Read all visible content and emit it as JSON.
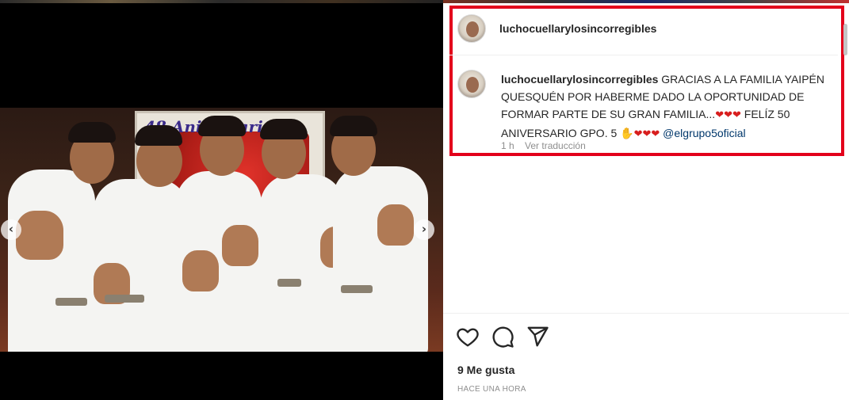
{
  "post": {
    "username": "luchocuellarylosincorregibles",
    "banner_text": "48 Aniversario",
    "caption": {
      "username": "luchocuellarylosincorregibles",
      "text_part1": "GRACIAS A LA FAMILIA YAIPÉN QUESQUÉN POR HABERME DADO LA OPORTUNIDAD DE FORMAR PARTE DE SU GRAN FAMILIA...",
      "hearts_a": "❤❤❤",
      "text_part2": "FELÍZ 50 ANIVERSARIO GPO. 5",
      "hand_emoji": "✋",
      "hearts_b": "❤❤❤",
      "mention": "@elgrupo5oficial"
    },
    "comment_meta": {
      "time": "1 h",
      "translate": "Ver traducción"
    },
    "likes": "9 Me gusta",
    "posted": "HACE UNA HORA",
    "nav_prev": "‹",
    "nav_next": "›"
  },
  "icons": {
    "like": "heart-outline-icon",
    "comment": "speech-bubble-icon",
    "share": "paper-plane-icon"
  },
  "colors": {
    "highlight_border": "#e3001b",
    "mention": "#00376b",
    "heart": "#d81e1e"
  }
}
